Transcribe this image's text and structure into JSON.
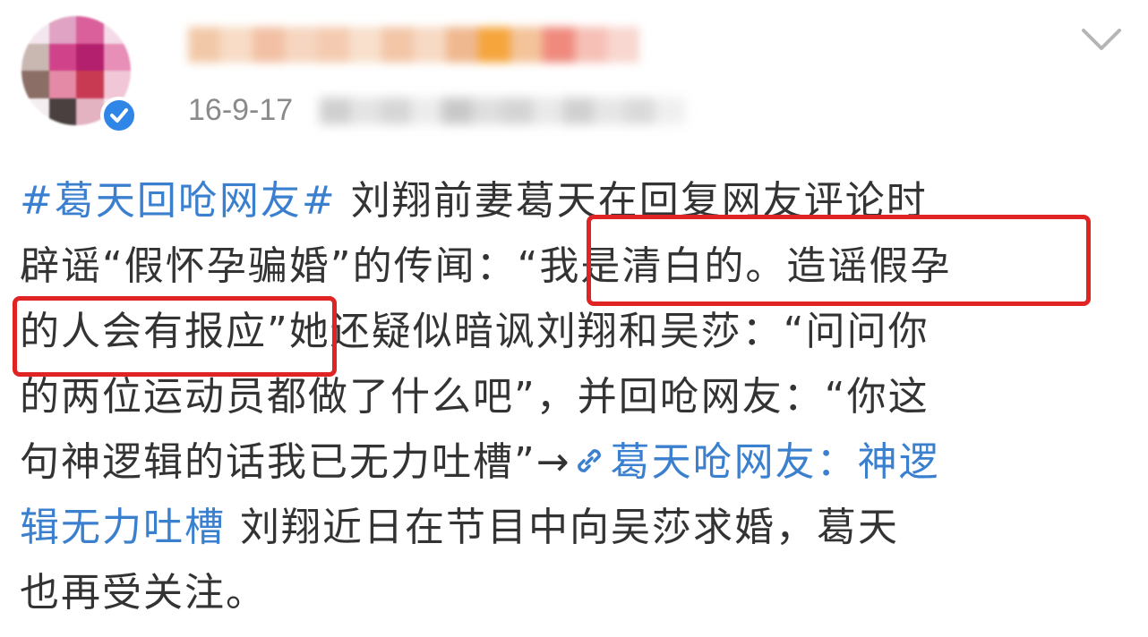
{
  "post": {
    "date": "16-9-17",
    "hashtag": "#葛天回呛网友#",
    "lines": [
      {
        "before": "",
        "hashtag": "#葛天回呛网友#",
        "text": " 刘翔前妻葛天在回复网友评论时"
      },
      {
        "text": "辟谣“假怀孕骗婚”的传闻：“我是清白的。造谣假孕"
      },
      {
        "text": "的人会有报应”她还疑似暗讽刘翔和吴莎：“问问你"
      },
      {
        "text": "的两位运动员都做了什么吧”，并回呛网友：“你这"
      },
      {
        "before": "句神逻辑的话我已无力吐槽”→",
        "link": "葛天呛网友：神逻"
      },
      {
        "link": "辑无力吐槽",
        "after": " 刘翔近日在节目中向吴莎求婚，葛天"
      },
      {
        "text": "也再受关注。"
      }
    ]
  },
  "icons": {
    "verified": "verified-badge-icon",
    "chevron": "chevron-down-icon",
    "link": "link-icon"
  },
  "colors": {
    "link": "#3b7fcf",
    "highlight": "#e02424",
    "verified": "#2f86e6",
    "meta": "#8a8a8a"
  }
}
